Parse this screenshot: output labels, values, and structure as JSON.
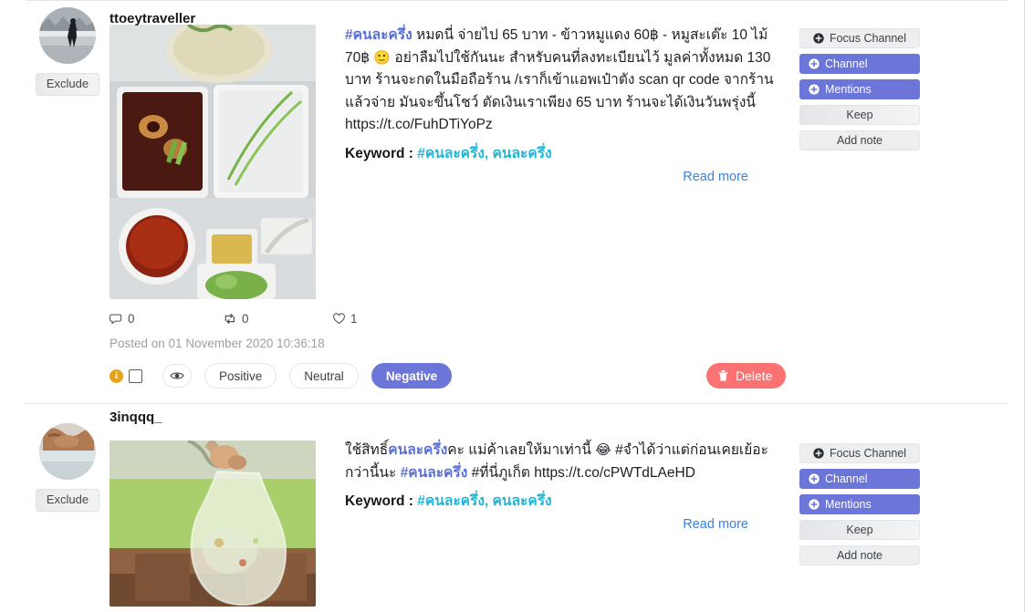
{
  "posts": [
    {
      "username": "ttoeytraveller",
      "exclude_label": "Exclude",
      "avatar_alt": "person-walking-by-water",
      "media_alt": "thai-food-takeaway-boxes",
      "text_parts": [
        {
          "t": "#คนละครึ่ง",
          "k": "tag"
        },
        {
          "t": " หมดนี่ จ่ายไป 65 บาท - ข้าวหมูแดง 60฿ - หมูสะเต๊ะ 10 ไม้ 70฿ ",
          "k": "plain"
        },
        {
          "t": "🙂",
          "k": "emoji"
        },
        {
          "t": " อย่าลืมไปใช้กันนะ สำหรับคนที่ลงทะเบียนไว้ มูลค่าทั้งหมด 130 บาท ร้านจะกดในมือถือร้าน /เราก็เข้าแอพเป๋าตัง scan qr code จากร้าน แล้วจ่าย มันจะขึ้นโชว์ ตัดเงินเราเพียง 65 บาท ร้านจะได้เงินวันพรุ่งนี้ https://t.co/FuhDTiYoPz",
          "k": "plain"
        }
      ],
      "keyword_label": "Keyword :",
      "keyword_values": "#คนละครึ่ง, คนละครึ่ง",
      "read_more": "Read more",
      "stats": {
        "comments": "0",
        "retweets": "0",
        "likes": "1"
      },
      "posted": "Posted on 01 November 2020 10:36:18",
      "actions": [
        {
          "label": "Focus Channel",
          "style": "grey",
          "icon": "plus-circle-icon"
        },
        {
          "label": "Channel",
          "style": "purple",
          "icon": "plus-circle-icon"
        },
        {
          "label": "Mentions",
          "style": "purple",
          "icon": "plus-circle-icon"
        },
        {
          "label": "Keep",
          "style": "keep",
          "icon": "none"
        },
        {
          "label": "Add note",
          "style": "grey",
          "icon": "none"
        }
      ],
      "sentiments": [
        {
          "label": "Positive",
          "active": false
        },
        {
          "label": "Neutral",
          "active": false
        },
        {
          "label": "Negative",
          "active": true
        }
      ],
      "delete_label": "Delete",
      "info_char": "i",
      "has_footer": true
    },
    {
      "username": "3inqqq_",
      "exclude_label": "Exclude",
      "avatar_alt": "hands-holding-object",
      "media_alt": "plastic-bag-of-food-held-up",
      "text_parts": [
        {
          "t": "ใช้สิทธิ์",
          "k": "plain"
        },
        {
          "t": "คนละครึ่ง",
          "k": "tag"
        },
        {
          "t": "คะ แม่ค้าเลยให้มาเท่านี้ ",
          "k": "plain"
        },
        {
          "t": "😂",
          "k": "emoji"
        },
        {
          "t": " #จำได้ว่าแต่ก่อนเคยเย้อะกว่านี้นะ ",
          "k": "plain"
        },
        {
          "t": "#คนละครึ่ง",
          "k": "tag"
        },
        {
          "t": " #ที่นี่ภูเก็ต https://t.co/cPWTdLAeHD",
          "k": "plain"
        }
      ],
      "keyword_label": "Keyword :",
      "keyword_values": "#คนละครึ่ง, คนละครึ่ง",
      "read_more": "Read more",
      "actions": [
        {
          "label": "Focus Channel",
          "style": "grey",
          "icon": "plus-circle-icon"
        },
        {
          "label": "Channel",
          "style": "purple",
          "icon": "plus-circle-icon"
        },
        {
          "label": "Mentions",
          "style": "purple",
          "icon": "plus-circle-icon"
        },
        {
          "label": "Keep",
          "style": "keep",
          "icon": "none"
        },
        {
          "label": "Add note",
          "style": "grey",
          "icon": "none"
        }
      ],
      "has_footer": false
    }
  ],
  "colors": {
    "accent_purple": "#6c75d8",
    "hashtag_blue": "#5a6fd6",
    "keyword_cyan": "#21b6d6",
    "link_blue": "#3b82d6",
    "delete_red": "#fb7272",
    "info_amber": "#e8a417",
    "muted_grey": "#9aa0a6"
  }
}
